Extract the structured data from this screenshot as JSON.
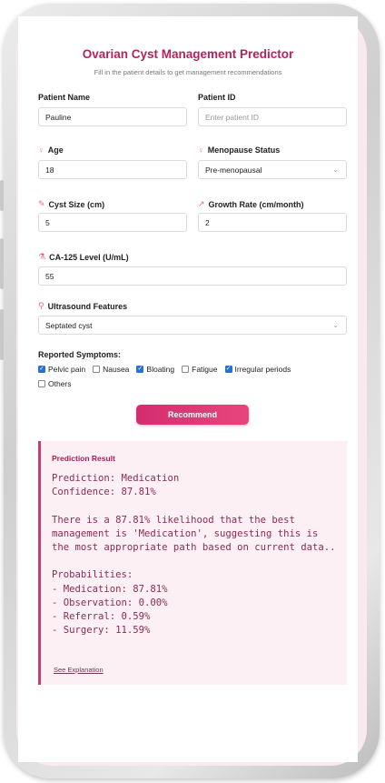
{
  "header": {
    "title": "Ovarian Cyst Management Predictor",
    "subtitle": "Fill in the patient details to get management recommendations"
  },
  "form": {
    "patient_name_label": "Patient Name",
    "patient_name_value": "Pauline",
    "patient_id_label": "Patient ID",
    "patient_id_placeholder": "Enter patient ID",
    "age_label": "Age",
    "age_value": "18",
    "menopause_label": "Menopause Status",
    "menopause_value": "Pre-menopausal",
    "cyst_size_label": "Cyst Size (cm)",
    "cyst_size_value": "5",
    "growth_rate_label": "Growth Rate (cm/month)",
    "growth_rate_value": "2",
    "ca125_label": "CA-125 Level (U/mL)",
    "ca125_value": "55",
    "ultrasound_label": "Ultrasound Features",
    "ultrasound_value": "Septated cyst"
  },
  "symptoms": {
    "title": "Reported Symptoms:",
    "items": [
      {
        "label": "Pelvic pain",
        "checked": true
      },
      {
        "label": "Nausea",
        "checked": false
      },
      {
        "label": "Bloating",
        "checked": true
      },
      {
        "label": "Fatigue",
        "checked": false
      },
      {
        "label": "Irregular periods",
        "checked": true
      },
      {
        "label": "Others",
        "checked": false
      }
    ]
  },
  "actions": {
    "recommend_label": "Recommend"
  },
  "result": {
    "title": "Prediction Result",
    "text": "Prediction: Medication\nConfidence: 87.81%\n\nThere is a 87.81% likelihood that the best management is 'Medication', suggesting this is the most appropriate path based on current data..\n\nProbabilities:\n- Medication: 87.81%\n- Observation: 0.00%\n- Referral: 0.59%\n- Surgery: 11.59%",
    "link_label": "See Explanation"
  },
  "colors": {
    "accent": "#b3245b",
    "button": "#d42d6e",
    "checkbox": "#2a6fd6",
    "result_bg": "#fdf0f5"
  }
}
